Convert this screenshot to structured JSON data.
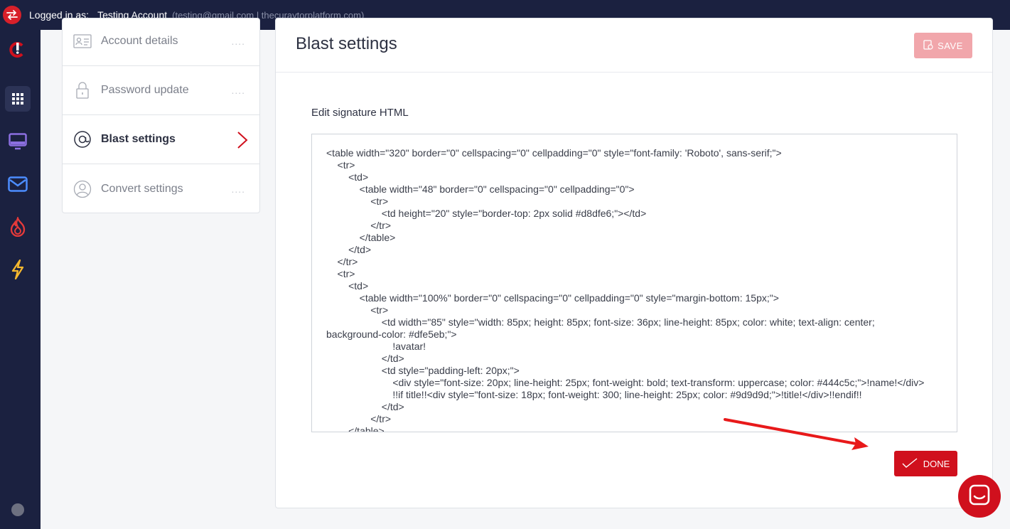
{
  "topbar": {
    "logged_in_label": "Logged in as:",
    "account_name": "Testing Account",
    "account_meta": "(testing@gmail.com | thecuraytorplatform.com)"
  },
  "sidebar_icons": [
    "logo-icon",
    "apps-grid-icon",
    "monitor-icon",
    "mail-icon",
    "flame-icon",
    "bolt-icon",
    "status-dot"
  ],
  "settings_menu": {
    "items": [
      {
        "label": "Account details",
        "icon": "id-card-icon",
        "dots": "...."
      },
      {
        "label": "Password update",
        "icon": "lock-icon",
        "dots": "...."
      },
      {
        "label": "Blast settings",
        "icon": "at-icon",
        "active": true
      },
      {
        "label": "Convert settings",
        "icon": "user-circle-icon",
        "dots": "...."
      }
    ]
  },
  "panel": {
    "title": "Blast settings",
    "save_label": "SAVE",
    "field_label": "Edit signature HTML",
    "done_label": "DONE"
  },
  "code_lines": [
    "<table width=\"320\" border=\"0\" cellspacing=\"0\" cellpadding=\"0\" style=\"font-family: 'Roboto', sans-serif;\">",
    "    <tr>",
    "        <td>",
    "            <table width=\"48\" border=\"0\" cellspacing=\"0\" cellpadding=\"0\">",
    "                <tr>",
    "                    <td height=\"20\" style=\"border-top: 2px solid #d8dfe6;\"></td>",
    "                </tr>",
    "            </table>",
    "        </td>",
    "    </tr>",
    "    <tr>",
    "        <td>",
    "            <table width=\"100%\" border=\"0\" cellspacing=\"0\" cellpadding=\"0\" style=\"margin-bottom: 15px;\">",
    "                <tr>",
    "                    <td width=\"85\" style=\"width: 85px; height: 85px; font-size: 36px; line-height: 85px; color: white; text-align: center;",
    "background-color: #dfe5eb;\">",
    "                        !avatar!",
    "                    </td>",
    "                    <td style=\"padding-left: 20px;\">",
    "                        <div style=\"font-size: 20px; line-height: 25px; font-weight: bold; text-transform: uppercase; color: #444c5c;\">!name!</div>",
    "                        !!if title!!<div style=\"font-size: 18px; font-weight: 300; line-height: 25px; color: #9d9d9d;\">!title!</div>!!endif!!",
    "                    </td>",
    "                </tr>",
    "        </table>"
  ],
  "colors": {
    "nav_bg": "#1b2140",
    "accent_red": "#d0101d",
    "save_disabled": "#f1a6ab",
    "monitor_icon": "#8b6fe0",
    "mail_icon": "#4c8dff",
    "flame_icon": "#e63a3a",
    "bolt_icon": "#f5b82e"
  }
}
